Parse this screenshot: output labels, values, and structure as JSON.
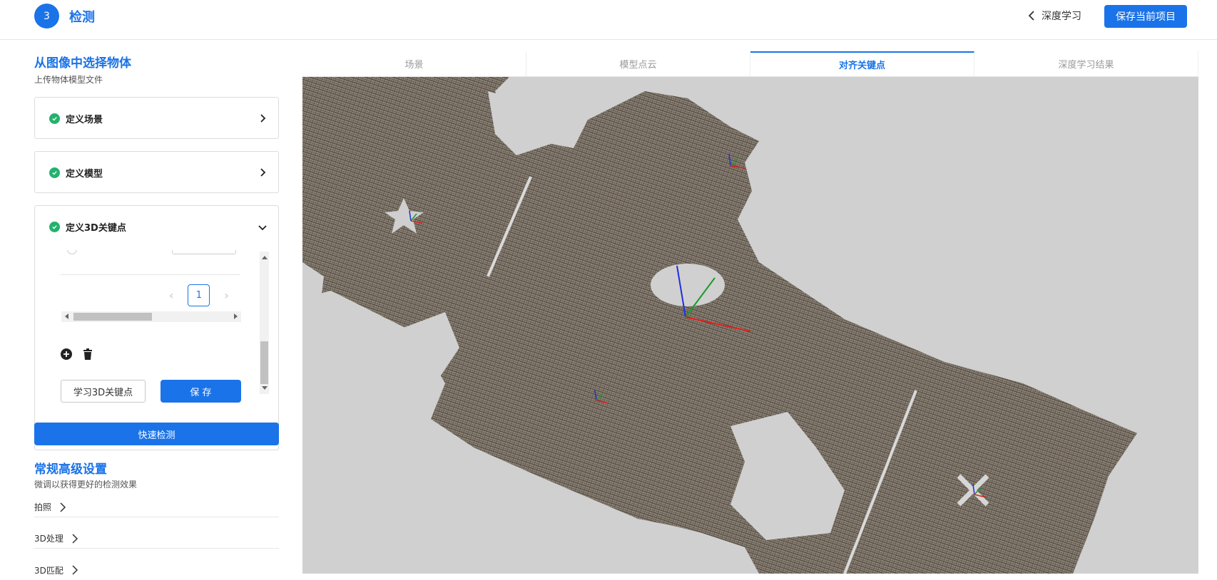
{
  "header": {
    "step_number": "3",
    "step_title": "检测",
    "back_label": "深度学习",
    "save_project_label": "保存当前项目"
  },
  "left": {
    "section_title": "从图像中选择物体",
    "section_subtitle": "上传物体模型文件",
    "steps": [
      {
        "label": "定义场景"
      },
      {
        "label": "定义模型"
      },
      {
        "label": "定义3D关键点"
      }
    ],
    "pagination": {
      "current_page": "1"
    },
    "learn_button": "学习3D关键点",
    "save_button": "保 存",
    "quick_detect_button": "快速检测",
    "advanced": {
      "title": "常规高级设置",
      "subtitle": "微调以获得更好的检测效果",
      "items": [
        "拍照",
        "3D处理",
        "3D匹配"
      ]
    }
  },
  "tabs": [
    {
      "label": "场景",
      "active": false
    },
    {
      "label": "模型点云",
      "active": false
    },
    {
      "label": "对齐关键点",
      "active": true
    },
    {
      "label": "深度学习结果",
      "active": false
    }
  ],
  "colors": {
    "accent": "#1a73e8",
    "success": "#23b26d",
    "viewer_bg": "#d0d0d0",
    "point_cloud": "#5a5045"
  }
}
